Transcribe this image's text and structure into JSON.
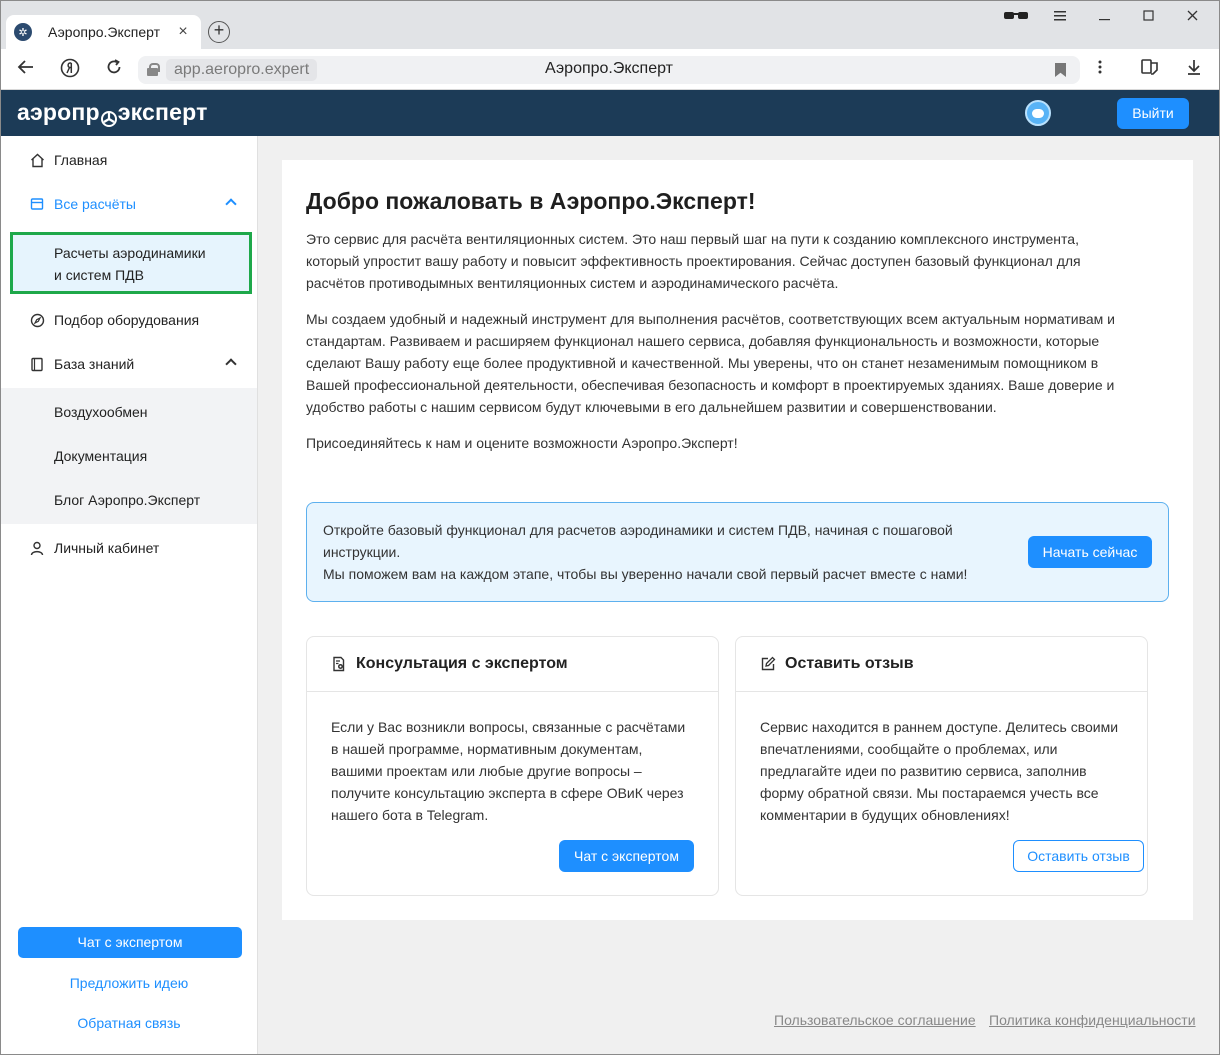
{
  "browser": {
    "tab_title": "Аэропро.Эксперт",
    "tab_close": "×",
    "new_tab": "+",
    "url_domain": "app.aeropro.expert",
    "url_title": "Аэропро.Эксперт",
    "icons": [
      "back-icon",
      "yandex-icon",
      "reload-icon",
      "lock-icon",
      "bookmark-icon",
      "menu-dots-icon",
      "collections-icon",
      "download-icon",
      "incognito-icon",
      "hamburger-icon",
      "minimize-icon",
      "maximize-icon",
      "close-icon"
    ]
  },
  "header": {
    "logo_left": "аэропр",
    "logo_right": "эксперт",
    "logout_label": "Выйти",
    "bg_color": "#1c3b57",
    "accent_color": "#1e8fff"
  },
  "sidebar": {
    "items": [
      {
        "label": "Главная",
        "icon": "home-icon"
      },
      {
        "label": "Все расчёты",
        "icon": "calculator-icon",
        "active": true
      },
      {
        "label": "Подбор оборудования",
        "icon": "compass-icon"
      },
      {
        "label": "База знаний",
        "icon": "book-icon"
      },
      {
        "label": "Личный кабинет",
        "icon": "user-icon"
      }
    ],
    "calc_sub": {
      "line1": "Расчеты аэродинамики",
      "line2": "и систем ПДВ"
    },
    "knowledge_sub": [
      "Воздухообмен",
      "Документация",
      "Блог Аэропро.Эксперт"
    ],
    "chat_button": "Чат с экспертом",
    "suggest_link": "Предложить идею",
    "feedback_link": "Обратная связь"
  },
  "main": {
    "title": "Добро пожаловать в Аэропро.Эксперт!",
    "paragraphs": [
      "Это сервис для расчёта вентиляционных систем. Это наш первый шаг на пути к созданию комплексного инструмента, который упростит вашу работу и повысит эффективность проектирования. Сейчас доступен базовый функционал для расчётов противодымных вентиляционных систем и аэродинамического расчёта.",
      "Мы создаем удобный и надежный инструмент для выполнения расчётов, соответствующих всем актуальным нормативам и стандартам. Развиваем и расширяем функционал нашего сервиса, добавляя функциональность и возможности, которые сделают Вашу работу еще более продуктивной и качественной. Мы уверены, что он станет незаменимым помощником в Вашей профессиональной деятельности, обеспечивая безопасность и комфорт в проектируемых зданиях. Ваше доверие и удобство работы с нашим сервисом будут ключевыми в его дальнейшем развитии и совершенствовании.",
      "Присоединяйтесь к нам и оцените возможности Аэропро.Эксперт!"
    ],
    "promo": {
      "line1": "Откройте базовый функционал для расчетов аэродинамики и систем ПДВ, начиная с пошаговой инструкции.",
      "line2": "Мы поможем вам на каждом этапе, чтобы вы уверенно начали свой первый расчет вместе с нами!",
      "button": "Начать сейчас"
    },
    "consult": {
      "title": "Консультация с экспертом",
      "text": "Если у Вас возникли вопросы, связанные с расчётами в нашей программе, нормативным документам, вашими проектам или любые другие вопросы – получите консультацию эксперта в сфере ОВиК через нашего бота в Telegram.",
      "button": "Чат с экспертом"
    },
    "review": {
      "title": "Оставить отзыв",
      "text": "Сервис находится в раннем доступе. Делитесь своими впечатлениями, сообщайте о проблемах, или предлагайте идеи по развитию сервиса, заполнив форму обратной связи. Мы постараемся учесть все комментарии в будущих обновлениях!",
      "button": "Оставить отзыв"
    }
  },
  "footer": {
    "terms": "Пользовательское соглашение",
    "privacy": "Политика конфиденциальности"
  }
}
